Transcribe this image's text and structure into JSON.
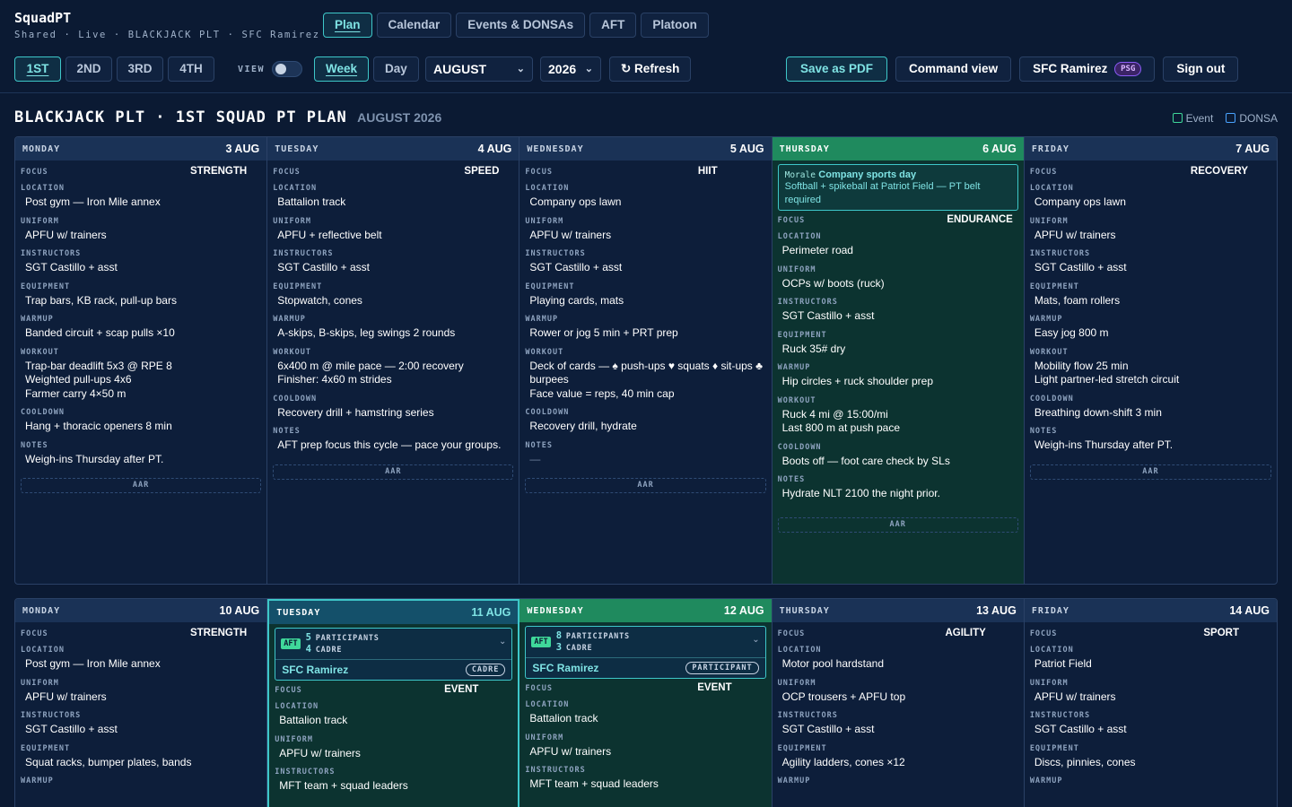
{
  "app": {
    "name": "SquadPT",
    "subtitle": "Shared · Live · BLACKJACK PLT · SFC Ramirez"
  },
  "nav_tabs": [
    {
      "label": "Plan",
      "active": true
    },
    {
      "label": "Calendar"
    },
    {
      "label": "Events & DONSAs"
    },
    {
      "label": "AFT"
    },
    {
      "label": "Platoon"
    }
  ],
  "squads": [
    {
      "label": "1ST",
      "active": true
    },
    {
      "label": "2ND"
    },
    {
      "label": "3RD"
    },
    {
      "label": "4TH"
    }
  ],
  "view": {
    "label": "VIEW",
    "week": "Week",
    "day": "Day",
    "active": "Week"
  },
  "month_select": "AUGUST",
  "year_select": "2026",
  "refresh_label": "↻ Refresh",
  "actions": {
    "pdf": "Save as PDF",
    "command": "Command view",
    "user": "SFC Ramirez",
    "user_badge": "PSG",
    "signout": "Sign out"
  },
  "page": {
    "title": "BLACKJACK PLT · 1ST SQUAD PT PLAN",
    "month": "AUGUST 2026"
  },
  "legend": {
    "event": "Event",
    "donsa": "DONSA",
    "event_color": "#3fd89a",
    "donsa_color": "#4aa3ff"
  },
  "labels": {
    "focus": "FOCUS",
    "location": "LOCATION",
    "uniform": "UNIFORM",
    "instructors": "INSTRUCTORS",
    "equipment": "EQUIPMENT",
    "warmup": "WARMUP",
    "workout": "WORKOUT",
    "cooldown": "COOLDOWN",
    "notes": "NOTES",
    "aar": "AAR",
    "participants": "PARTICIPANTS",
    "cadre": "CADRE"
  },
  "colors": {
    "background": "#0b1a33",
    "accent": "#3ec7c9",
    "event_header": "#1f8a5e",
    "header": "#1a3256"
  },
  "week1": [
    {
      "day": "MONDAY",
      "date": "3 AUG",
      "focus": "STRENGTH",
      "location": "Post gym — Iron Mile annex",
      "uniform": "APFU w/ trainers",
      "instructors": "SGT Castillo + asst",
      "equipment": "Trap bars, KB rack, pull-up bars",
      "warmup": "Banded circuit + scap pulls ×10",
      "workout": [
        "Trap-bar deadlift 5x3 @ RPE 8",
        "Weighted pull-ups 4x6",
        "Farmer carry 4×50 m"
      ],
      "cooldown": "Hang + thoracic openers 8 min",
      "notes": "Weigh-ins Thursday after PT."
    },
    {
      "day": "TUESDAY",
      "date": "4 AUG",
      "focus": "SPEED",
      "location": "Battalion track",
      "uniform": "APFU + reflective belt",
      "instructors": "SGT Castillo + asst",
      "equipment": "Stopwatch, cones",
      "warmup": "A-skips, B-skips, leg swings 2 rounds",
      "workout": [
        "6x400 m @ mile pace — 2:00 recovery",
        "Finisher: 4x60 m strides"
      ],
      "cooldown": "Recovery drill + hamstring series",
      "notes": "AFT prep focus this cycle — pace your groups."
    },
    {
      "day": "WEDNESDAY",
      "date": "5 AUG",
      "focus": "HIIT",
      "location": "Company ops lawn",
      "uniform": "APFU w/ trainers",
      "instructors": "SGT Castillo + asst",
      "equipment": "Playing cards, mats",
      "warmup": "Rower or jog 5 min + PRT prep",
      "workout": [
        "Deck of cards — ♠ push-ups ♥ squats ♦ sit-ups ♣ burpees",
        "Face value = reps, 40 min cap"
      ],
      "cooldown": "Recovery drill, hydrate",
      "notes": "—"
    },
    {
      "day": "THURSDAY",
      "date": "6 AUG",
      "event_tag": "Morale",
      "event_title": "Company sports day",
      "event_desc": "Softball + spikeball at Patriot Field — PT belt required",
      "focus": "ENDURANCE",
      "location": "Perimeter road",
      "uniform": "OCPs w/ boots (ruck)",
      "instructors": "SGT Castillo + asst",
      "equipment": "Ruck 35# dry",
      "warmup": "Hip circles + ruck shoulder prep",
      "workout": [
        "Ruck 4 mi @ 15:00/mi",
        "Last 800 m at push pace"
      ],
      "cooldown": "Boots off — foot care check by SLs",
      "notes": "Hydrate NLT 2100 the night prior."
    },
    {
      "day": "FRIDAY",
      "date": "7 AUG",
      "focus": "RECOVERY",
      "location": "Company ops lawn",
      "uniform": "APFU w/ trainers",
      "instructors": "SGT Castillo + asst",
      "equipment": "Mats, foam rollers",
      "warmup": "Easy jog 800 m",
      "workout": [
        "Mobility flow 25 min",
        "Light partner-led stretch circuit"
      ],
      "cooldown": "Breathing down-shift 3 min",
      "notes": "Weigh-ins Thursday after PT."
    }
  ],
  "week2": [
    {
      "day": "MONDAY",
      "date": "10 AUG",
      "focus": "STRENGTH",
      "location": "Post gym — Iron Mile annex",
      "uniform": "APFU w/ trainers",
      "instructors": "SGT Castillo + asst",
      "equipment": "Squat racks, bumper plates, bands"
    },
    {
      "day": "TUESDAY",
      "date": "11 AUG",
      "aft_tag": "AFT",
      "aft_participants": "5",
      "aft_cadre": "4",
      "aft_person": "SFC Ramirez",
      "aft_role": "CADRE",
      "focus": "EVENT",
      "location": "Battalion track",
      "uniform": "APFU w/ trainers",
      "instructors": "MFT team + squad leaders"
    },
    {
      "day": "WEDNESDAY",
      "date": "12 AUG",
      "aft_tag": "AFT",
      "aft_participants": "8",
      "aft_cadre": "3",
      "aft_person": "SFC Ramirez",
      "aft_role": "PARTICIPANT",
      "focus": "EVENT",
      "location": "Battalion track",
      "uniform": "APFU w/ trainers",
      "instructors": "MFT team + squad leaders"
    },
    {
      "day": "THURSDAY",
      "date": "13 AUG",
      "focus": "AGILITY",
      "location": "Motor pool hardstand",
      "uniform": "OCP trousers + APFU top",
      "instructors": "SGT Castillo + asst",
      "equipment": "Agility ladders, cones ×12"
    },
    {
      "day": "FRIDAY",
      "date": "14 AUG",
      "focus": "SPORT",
      "location": "Patriot Field",
      "uniform": "APFU w/ trainers",
      "instructors": "SGT Castillo + asst",
      "equipment": "Discs, pinnies, cones"
    }
  ]
}
